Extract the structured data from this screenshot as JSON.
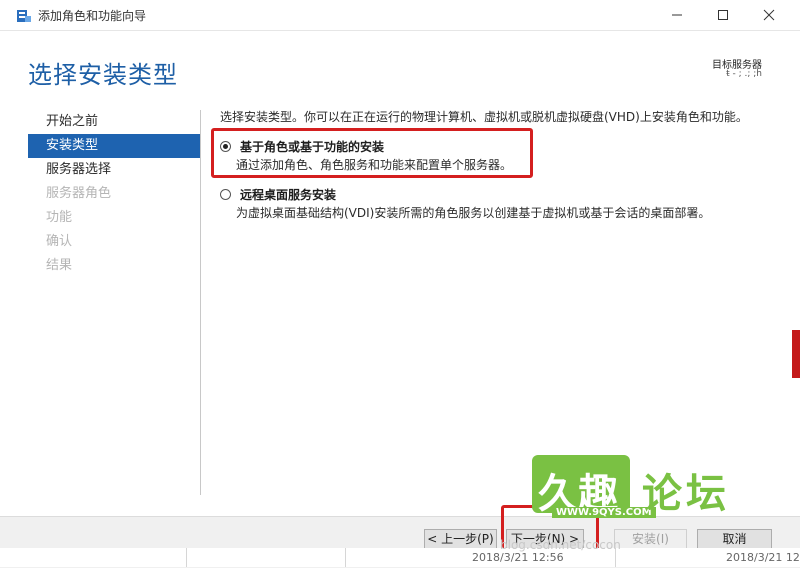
{
  "window": {
    "title": "添加角色和功能向导",
    "app_icon": "server-manager-icon",
    "controls": [
      "minimize-icon",
      "maximize-icon",
      "close-icon"
    ]
  },
  "header": {
    "title": "选择安装类型",
    "destination_label": "目标服务器",
    "destination_value": "ŧ - ; .; ;h"
  },
  "nav": {
    "items": [
      {
        "label": "开始之前",
        "state": "normal"
      },
      {
        "label": "安装类型",
        "state": "active"
      },
      {
        "label": "服务器选择",
        "state": "normal"
      },
      {
        "label": "服务器角色",
        "state": "disabled"
      },
      {
        "label": "功能",
        "state": "disabled"
      },
      {
        "label": "确认",
        "state": "disabled"
      },
      {
        "label": "结果",
        "state": "disabled"
      }
    ]
  },
  "content": {
    "intro": "选择安装类型。你可以在正在运行的物理计算机、虚拟机或脱机虚拟硬盘(VHD)上安装角色和功能。",
    "options": [
      {
        "title": "基于角色或基于功能的安装",
        "desc": "通过添加角色、角色服务和功能来配置单个服务器。",
        "checked": true
      },
      {
        "title": "远程桌面服务安装",
        "desc": "为虚拟桌面基础结构(VDI)安装所需的角色服务以创建基于虚拟机或基于会话的桌面部署。",
        "checked": false
      }
    ]
  },
  "footer": {
    "prev": "< 上一步(P)",
    "next": "下一步(N) >",
    "install": "安装(I)",
    "cancel": "取消"
  },
  "taskbar_text": {
    "left": "2018/3/21 12:56",
    "right": "2018/3/21 12"
  },
  "watermark": {
    "logo": "久趣",
    "text": "论坛",
    "url": "WWW.9QYS.COM",
    "faint_url": "blog.csdn.net/cocon"
  },
  "colors": {
    "accent": "#1e63b0",
    "title": "#1e5fa6",
    "highlight": "#d41f1f",
    "watermark": "#7ac143"
  }
}
